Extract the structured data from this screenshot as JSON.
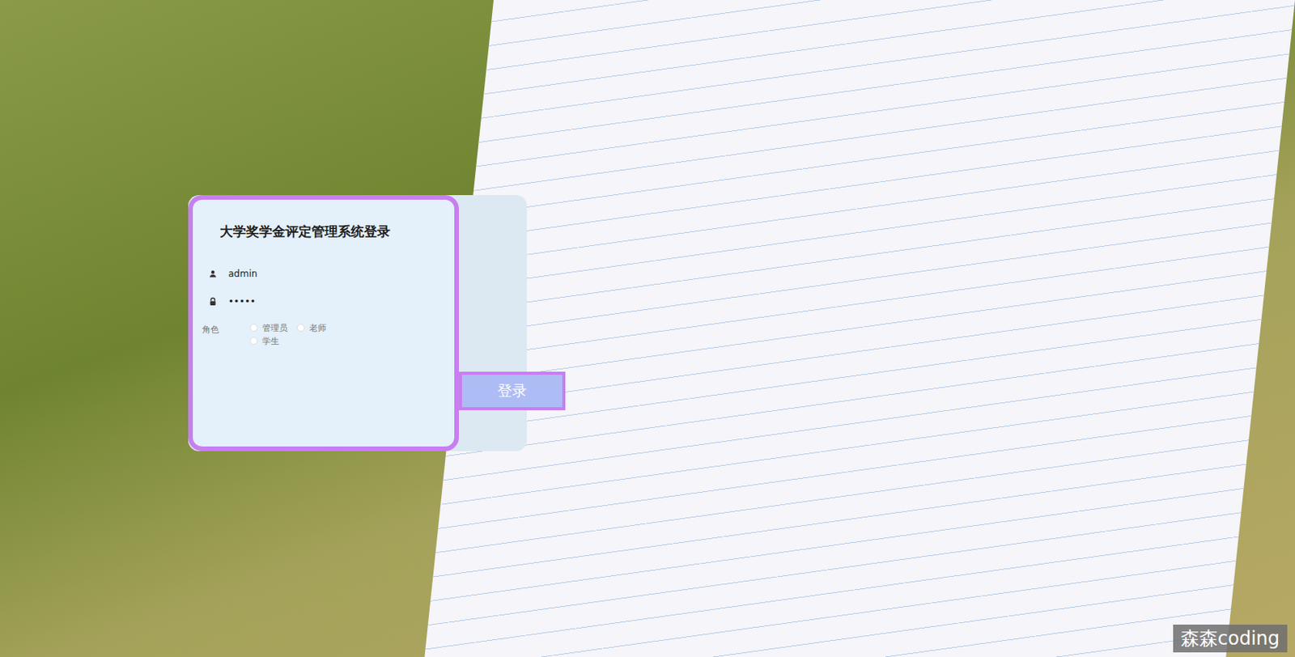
{
  "login": {
    "title": "大学奖学金评定管理系统登录",
    "username": {
      "value": "admin"
    },
    "password": {
      "value": "•••••"
    },
    "role": {
      "label": "角色",
      "options": [
        {
          "label": "管理员",
          "selected": false
        },
        {
          "label": "老师",
          "selected": false
        },
        {
          "label": "学生",
          "selected": false
        }
      ]
    },
    "button": "登录"
  },
  "watermark": "森森coding"
}
